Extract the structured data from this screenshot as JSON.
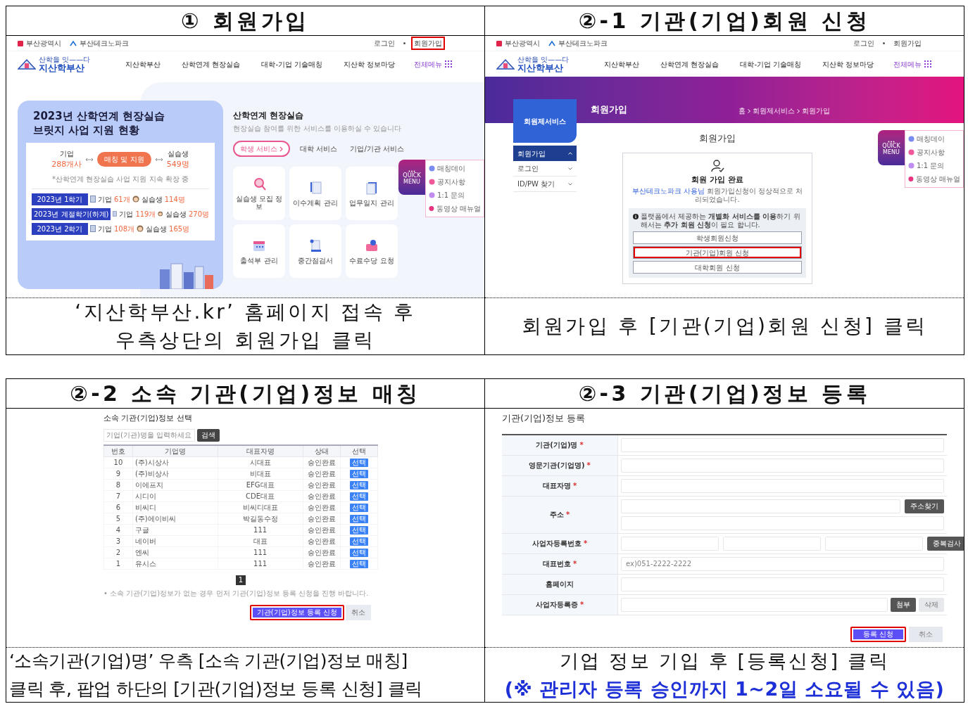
{
  "required_mark": "*",
  "panels": [
    {
      "kind": "home",
      "heading": "① 회원가입",
      "caption": [
        {
          "text": "‘지산학부산.kr’ 홈페이지 접속 후",
          "emphasis": false
        },
        {
          "text": "우측상단의 회원가입 클릭",
          "emphasis": false
        }
      ],
      "screen": {
        "top_links_left": [
          "부산광역시",
          "부산테크노파크"
        ],
        "top_links_right": [
          {
            "label": "로그인",
            "highlighted": false
          },
          {
            "label": "회원가입",
            "highlighted": true
          }
        ],
        "logo": {
          "tagline": "산학을 잇——다",
          "name": "지산학부산"
        },
        "nav": [
          "지산학부산",
          "산학연계 현장실습",
          "대학-기업 기술매칭",
          "지산학 정보마당"
        ],
        "all_menu": "전체메뉴",
        "status_card": {
          "title_lines": [
            "2023년 산학연계 현장실습",
            "브릿지 사업 지원 현황"
          ],
          "left_label": "기업",
          "left_value": "288개사",
          "badge": "매칭 및 지원",
          "right_label": "실습생",
          "right_value": "549명",
          "note": "*산학연계 현장실습 사업 지원 지속 확장 중",
          "rows": [
            {
              "term": "2023년 1학기",
              "company_label": "기업",
              "company_count": "61개",
              "student_label": "실습생",
              "student_count": "114명"
            },
            {
              "term": "2023년 계절학기(하계)",
              "company_label": "기업",
              "company_count": "119개",
              "student_label": "실습생",
              "student_count": "270명"
            },
            {
              "term": "2023년 2학기",
              "company_label": "기업",
              "company_count": "108개",
              "student_label": "실습생",
              "student_count": "165명"
            }
          ]
        },
        "section": {
          "title": "산학연계 현장실습",
          "subtitle": "현장실습 참여를 위한 서비스를 이용하실 수 있습니다",
          "tabs": [
            {
              "label": "학생 서비스",
              "selected": true
            },
            {
              "label": "대학 서비스",
              "selected": false
            },
            {
              "label": "기업/기관 서비스",
              "selected": false
            }
          ],
          "services": [
            "실습생 모집 정보",
            "이수계획 관리",
            "업무일지 관리",
            "출석부 관리",
            "중간점검서",
            "수료수당 요청"
          ]
        },
        "quick_menu": {
          "title": "QUICK MENU",
          "items": [
            "매칭데이",
            "공지사항",
            "1:1 문의",
            "동영상 매뉴얼"
          ]
        }
      }
    },
    {
      "kind": "signup",
      "heading": "②-1 기관(기업)회원 신청",
      "caption": [
        {
          "text": "회원가입 후 [기관(기업)회원 신청] 클릭",
          "emphasis": false
        }
      ],
      "screen": {
        "top_links_left": [
          "부산광역시",
          "부산테크노파크"
        ],
        "top_links_right": [
          {
            "label": "로그인",
            "highlighted": false
          },
          {
            "label": "회원가입",
            "highlighted": false
          }
        ],
        "logo": {
          "tagline": "산학을 잇——다",
          "name": "지산학부산"
        },
        "nav": [
          "지산학부산",
          "산학연계 현장실습",
          "대학-기업 기술매칭",
          "지산학 정보마당"
        ],
        "all_menu": "전체메뉴",
        "banner": {
          "title": "회원가입",
          "breadcrumb": [
            "홈",
            "회원제서비스",
            "회원가입"
          ]
        },
        "side": {
          "title": "회원제서비스",
          "items": [
            {
              "label": "회원가입",
              "selected": true,
              "expanded": true
            },
            {
              "label": "로그인",
              "selected": false,
              "expanded": false
            },
            {
              "label": "ID/PW 찾기",
              "selected": false,
              "expanded": false
            }
          ]
        },
        "heading": "회원가입",
        "card": {
          "title": "회원 가입 완료",
          "message_parts": [
            "부산테크노파크 사용님",
            "회원가입신청이 정상적으로 처리되었습니다."
          ],
          "notice": "플랫폼에서 제공하는 **개별화 서비스를 이용**하기 위해서는 **추가 회원 신청**이 필요 합니다.",
          "buttons": [
            {
              "label": "학생회원신청",
              "highlighted": false
            },
            {
              "label": "기관(기업)회원 신청",
              "highlighted": true
            },
            {
              "label": "대학회원 신청",
              "highlighted": false
            }
          ]
        },
        "quick_menu": {
          "title": "QUICK MENU",
          "items": [
            "매칭데이",
            "공지사항",
            "1:1 문의",
            "동영상 매뉴얼"
          ]
        }
      }
    },
    {
      "kind": "match",
      "heading": "②-2 소속 기관(기업)정보 매칭",
      "caption": [
        {
          "text": "‘소속기관(기업)명’ 우측 [소속 기관(기업)정보 매칭]",
          "emphasis": false
        },
        {
          "text": "클릭 후, 팝업 하단의 [기관(기업)정보 등록 신청] 클릭",
          "emphasis": false
        }
      ],
      "screen": {
        "title": "소속 기관(기업)정보 선택",
        "search": {
          "placeholder": "기업(기관)명을 입력하세요",
          "button": "검색"
        },
        "columns": [
          "번호",
          "기업명",
          "대표자명",
          "상태",
          "선택"
        ],
        "rows": [
          {
            "no": "10",
            "name": "(주)시상사",
            "representative": "시대표",
            "status": "승인완료",
            "action": "선택"
          },
          {
            "no": "9",
            "name": "(주)비상사",
            "representative": "비대표",
            "status": "승인완료",
            "action": "선택"
          },
          {
            "no": "8",
            "name": "이에프지",
            "representative": "EFG대표",
            "status": "승인완료",
            "action": "선택"
          },
          {
            "no": "7",
            "name": "시디이",
            "representative": "CDE대표",
            "status": "승인완료",
            "action": "선택"
          },
          {
            "no": "6",
            "name": "비씨디",
            "representative": "비씨디대표",
            "status": "승인완료",
            "action": "선택"
          },
          {
            "no": "5",
            "name": "(주)에이비씨",
            "representative": "박길동수정",
            "status": "승인완료",
            "action": "선택"
          },
          {
            "no": "4",
            "name": "구글",
            "representative": "111",
            "status": "승인완료",
            "action": "선택"
          },
          {
            "no": "3",
            "name": "네이버",
            "representative": "대표",
            "status": "승인완료",
            "action": "선택"
          },
          {
            "no": "2",
            "name": "엔씨",
            "representative": "111",
            "status": "승인완료",
            "action": "선택"
          },
          {
            "no": "1",
            "name": "유시스",
            "representative": "111",
            "status": "승인완료",
            "action": "선택"
          }
        ],
        "pages": [
          {
            "label": "1",
            "selected": true
          }
        ],
        "note": "• 소속 기관(기업)정보가 없는 경우 먼저 기관(기업)정보 등록 신청을 진행 바랍니다.",
        "buttons": [
          {
            "label": "기관(기업)정보 등록 신청",
            "kind": "primary",
            "highlighted": true
          },
          {
            "label": "취소",
            "kind": "secondary",
            "highlighted": false
          }
        ]
      }
    },
    {
      "kind": "register",
      "heading": "②-3 기관(기업)정보 등록",
      "caption": [
        {
          "text": "기업 정보 기입 후 [등록신청] 클릭",
          "emphasis": false
        },
        {
          "text": "(※ 관리자 등록 승인까지 1~2일 소요될 수 있음)",
          "emphasis": true
        }
      ],
      "screen": {
        "title": "기관(기업)정보 등록",
        "fields": [
          {
            "label": "기관(기업)명",
            "required": true,
            "kind": "text"
          },
          {
            "label": "영문기관(기업명)",
            "required": true,
            "kind": "text"
          },
          {
            "label": "대표자명",
            "required": true,
            "kind": "text"
          },
          {
            "label": "주소",
            "required": true,
            "kind": "address",
            "buttons": [
              "주소찾기"
            ]
          },
          {
            "label": "사업자등록번호",
            "required": true,
            "kind": "triple",
            "buttons": [
              "중복검사"
            ]
          },
          {
            "label": "대표번호",
            "required": true,
            "kind": "text",
            "placeholder": "ex)051-2222-2222"
          },
          {
            "label": "홈페이지",
            "required": false,
            "kind": "text"
          },
          {
            "label": "사업자등록증",
            "required": true,
            "kind": "file",
            "buttons": [
              "첨부",
              "삭제"
            ]
          }
        ],
        "buttons": [
          {
            "label": "등록 신청",
            "kind": "primary",
            "highlighted": true
          },
          {
            "label": "취소",
            "kind": "secondary",
            "highlighted": false
          }
        ]
      }
    }
  ]
}
